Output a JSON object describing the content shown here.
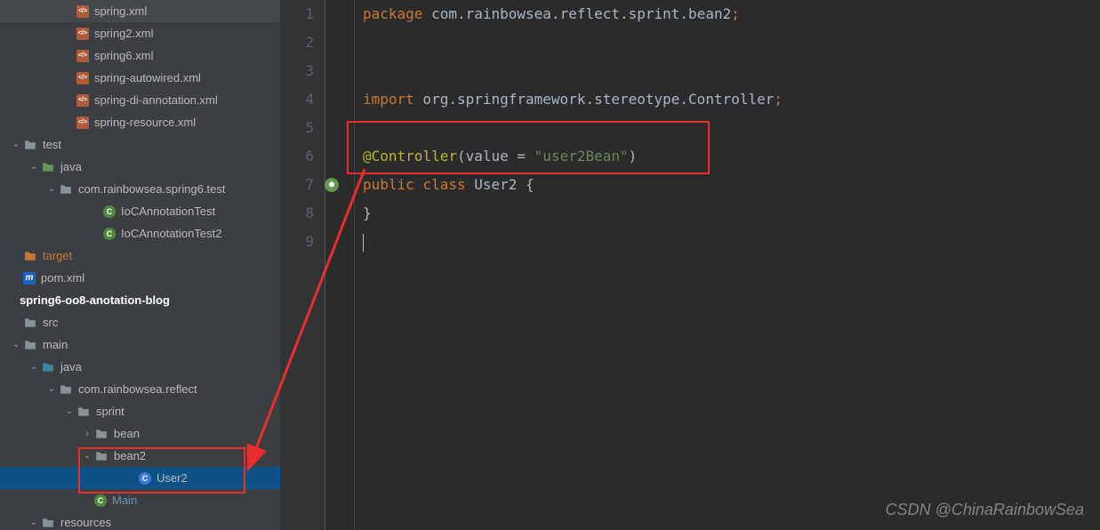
{
  "sidebar": {
    "items": [
      {
        "indent": 70,
        "arrow": "none",
        "icon": "xml",
        "label": "spring.xml",
        "cls": ""
      },
      {
        "indent": 70,
        "arrow": "none",
        "icon": "xml",
        "label": "spring2.xml",
        "cls": ""
      },
      {
        "indent": 70,
        "arrow": "none",
        "icon": "xml",
        "label": "spring6.xml",
        "cls": ""
      },
      {
        "indent": 70,
        "arrow": "none",
        "icon": "xml",
        "label": "spring-autowired.xml",
        "cls": ""
      },
      {
        "indent": 70,
        "arrow": "none",
        "icon": "xml",
        "label": "spring-di-annotation.xml",
        "cls": ""
      },
      {
        "indent": 70,
        "arrow": "none",
        "icon": "xml",
        "label": "spring-resource.xml",
        "cls": ""
      },
      {
        "indent": 10,
        "arrow": "expanded",
        "icon": "folder-gray",
        "label": "test",
        "cls": ""
      },
      {
        "indent": 30,
        "arrow": "expanded",
        "icon": "folder-green",
        "label": "java",
        "cls": ""
      },
      {
        "indent": 50,
        "arrow": "expanded",
        "icon": "folder-gray",
        "label": "com.rainbowsea.spring6.test",
        "cls": ""
      },
      {
        "indent": 100,
        "arrow": "none",
        "icon": "class-green",
        "label": "IoCAnnotationTest",
        "cls": ""
      },
      {
        "indent": 100,
        "arrow": "none",
        "icon": "class-green",
        "label": "IoCAnnotationTest2",
        "cls": ""
      },
      {
        "indent": 10,
        "arrow": "none",
        "icon": "folder-orange",
        "label": "target",
        "cls": "orange"
      },
      {
        "indent": 10,
        "arrow": "none",
        "icon": "maven",
        "label": "pom.xml",
        "cls": ""
      },
      {
        "indent": 0,
        "arrow": "none",
        "icon": "none",
        "label": "spring6-oo8-anotation-blog",
        "cls": "bold"
      },
      {
        "indent": 10,
        "arrow": "none",
        "icon": "folder-gray",
        "label": "src",
        "cls": ""
      },
      {
        "indent": 10,
        "arrow": "expanded",
        "icon": "folder-gray",
        "label": "main",
        "cls": ""
      },
      {
        "indent": 30,
        "arrow": "expanded",
        "icon": "folder-teal",
        "label": "java",
        "cls": ""
      },
      {
        "indent": 50,
        "arrow": "expanded",
        "icon": "folder-gray",
        "label": "com.rainbowsea.reflect",
        "cls": ""
      },
      {
        "indent": 70,
        "arrow": "expanded",
        "icon": "folder-gray",
        "label": "sprint",
        "cls": ""
      },
      {
        "indent": 90,
        "arrow": "collapsed",
        "icon": "folder-gray",
        "label": "bean",
        "cls": ""
      },
      {
        "indent": 90,
        "arrow": "expanded",
        "icon": "folder-gray",
        "label": "bean2",
        "cls": ""
      },
      {
        "indent": 140,
        "arrow": "none",
        "icon": "class-blue",
        "label": "User2",
        "cls": "",
        "selected": true
      },
      {
        "indent": 90,
        "arrow": "none",
        "icon": "class-green",
        "label": "Main",
        "cls": "blue"
      },
      {
        "indent": 30,
        "arrow": "expanded",
        "icon": "folder-gray",
        "label": "resources",
        "cls": ""
      }
    ]
  },
  "editor": {
    "lines": [
      {
        "n": 1,
        "tokens": [
          [
            "kw",
            "package"
          ],
          [
            "pkg",
            " com.rainbowsea.reflect.sprint.bean2"
          ],
          [
            "semi",
            ";"
          ]
        ]
      },
      {
        "n": 2,
        "tokens": []
      },
      {
        "n": 3,
        "tokens": []
      },
      {
        "n": 4,
        "tokens": [
          [
            "kw",
            "import"
          ],
          [
            "pkg",
            " org.springframework.stereotype.Controller"
          ],
          [
            "semi",
            ";"
          ]
        ]
      },
      {
        "n": 5,
        "tokens": []
      },
      {
        "n": 6,
        "tokens": [
          [
            "ann",
            "@Controller"
          ],
          [
            "punct",
            "("
          ],
          [
            "ident",
            "value = "
          ],
          [
            "str",
            "\"user2Bean\""
          ],
          [
            "punct",
            ")"
          ]
        ]
      },
      {
        "n": 7,
        "tokens": [
          [
            "kw",
            "public class "
          ],
          [
            "cls",
            "User2"
          ],
          [
            "punct",
            " {"
          ]
        ]
      },
      {
        "n": 8,
        "tokens": [
          [
            "punct",
            "}"
          ]
        ]
      },
      {
        "n": 9,
        "tokens": [],
        "cursor": true
      }
    ]
  },
  "watermark": "CSDN @ChinaRainbowSea"
}
